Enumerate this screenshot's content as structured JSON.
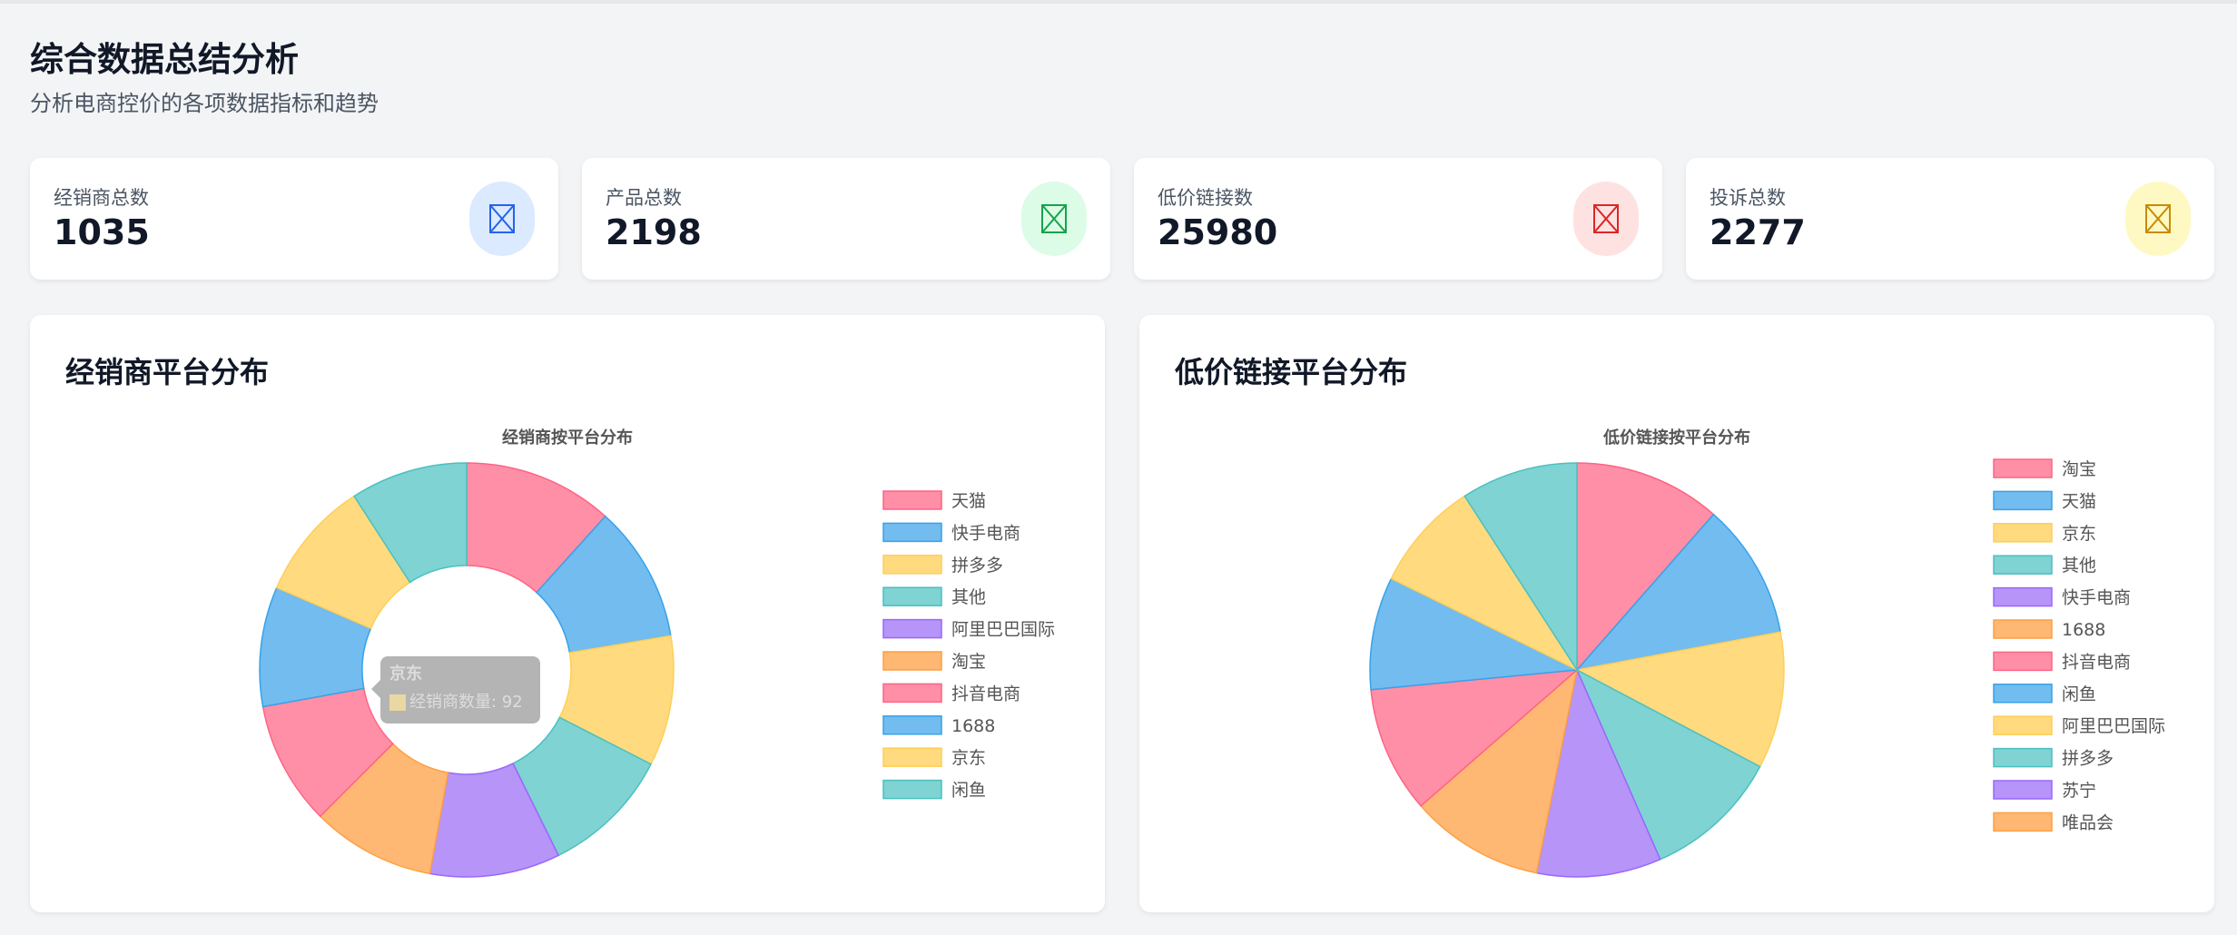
{
  "header": {
    "title": "综合数据总结分析",
    "subtitle": "分析电商控价的各项数据指标和趋势"
  },
  "stats": [
    {
      "label": "经销商总数",
      "value": "1035",
      "icon": "image-placeholder-icon",
      "bg": "#dbeafe",
      "fg": "#2563eb"
    },
    {
      "label": "产品总数",
      "value": "2198",
      "icon": "image-placeholder-icon",
      "bg": "#dcfce7",
      "fg": "#16a34a"
    },
    {
      "label": "低价链接数",
      "value": "25980",
      "icon": "image-placeholder-icon",
      "bg": "#fee2e2",
      "fg": "#dc2626"
    },
    {
      "label": "投诉总数",
      "value": "2277",
      "icon": "image-placeholder-icon",
      "bg": "#fef9c3",
      "fg": "#ca8a04"
    }
  ],
  "panels": [
    {
      "title": "经销商平台分布"
    },
    {
      "title": "低价链接平台分布"
    }
  ],
  "chart_data": [
    {
      "type": "pie",
      "variant": "doughnut",
      "title": "经销商按平台分布",
      "legend_position": "right",
      "categories": [
        "天猫",
        "快手电商",
        "拼多多",
        "其他",
        "阿里巴巴国际",
        "淘宝",
        "抖音电商",
        "1688",
        "京东",
        "闲鱼"
      ],
      "values": [
        115,
        105,
        100,
        100,
        100,
        95,
        95,
        92,
        92,
        90
      ],
      "colors": {
        "fill": [
          "#ff8fa6",
          "#72bcef",
          "#ffda7f",
          "#7fd3d3",
          "#b794f8",
          "#ffb873",
          "#ff8fa6",
          "#72bcef",
          "#ffda7f",
          "#7fd3d3"
        ],
        "stroke": [
          "#ff6384",
          "#36a2eb",
          "#ffce56",
          "#4bc0c0",
          "#9966ff",
          "#ff9f40",
          "#ff6384",
          "#36a2eb",
          "#ffce56",
          "#4bc0c0"
        ]
      },
      "tooltip": {
        "title": "京东",
        "line": "经销商数量: 92",
        "swatch": "#e9d7a4"
      }
    },
    {
      "type": "pie",
      "title": "低价链接按平台分布",
      "legend_position": "right",
      "categories": [
        "淘宝",
        "天猫",
        "京东",
        "其他",
        "快手电商",
        "1688",
        "抖音电商",
        "闲鱼",
        "阿里巴巴国际",
        "拼多多",
        "苏宁",
        "唯品会"
      ],
      "values": [
        2750,
        2540,
        2560,
        2560,
        2330,
        2510,
        2370,
        2110,
        2060,
        2190,
        0,
        0
      ],
      "colors": {
        "fill": [
          "#ff8fa6",
          "#72bcef",
          "#ffda7f",
          "#7fd3d3",
          "#b794f8",
          "#ffb873",
          "#ff8fa6",
          "#72bcef",
          "#ffda7f",
          "#7fd3d3",
          "#b794f8",
          "#ffb873"
        ],
        "stroke": [
          "#ff6384",
          "#36a2eb",
          "#ffce56",
          "#4bc0c0",
          "#9966ff",
          "#ff9f40",
          "#ff6384",
          "#36a2eb",
          "#ffce56",
          "#4bc0c0",
          "#9966ff",
          "#ff9f40"
        ]
      }
    }
  ]
}
